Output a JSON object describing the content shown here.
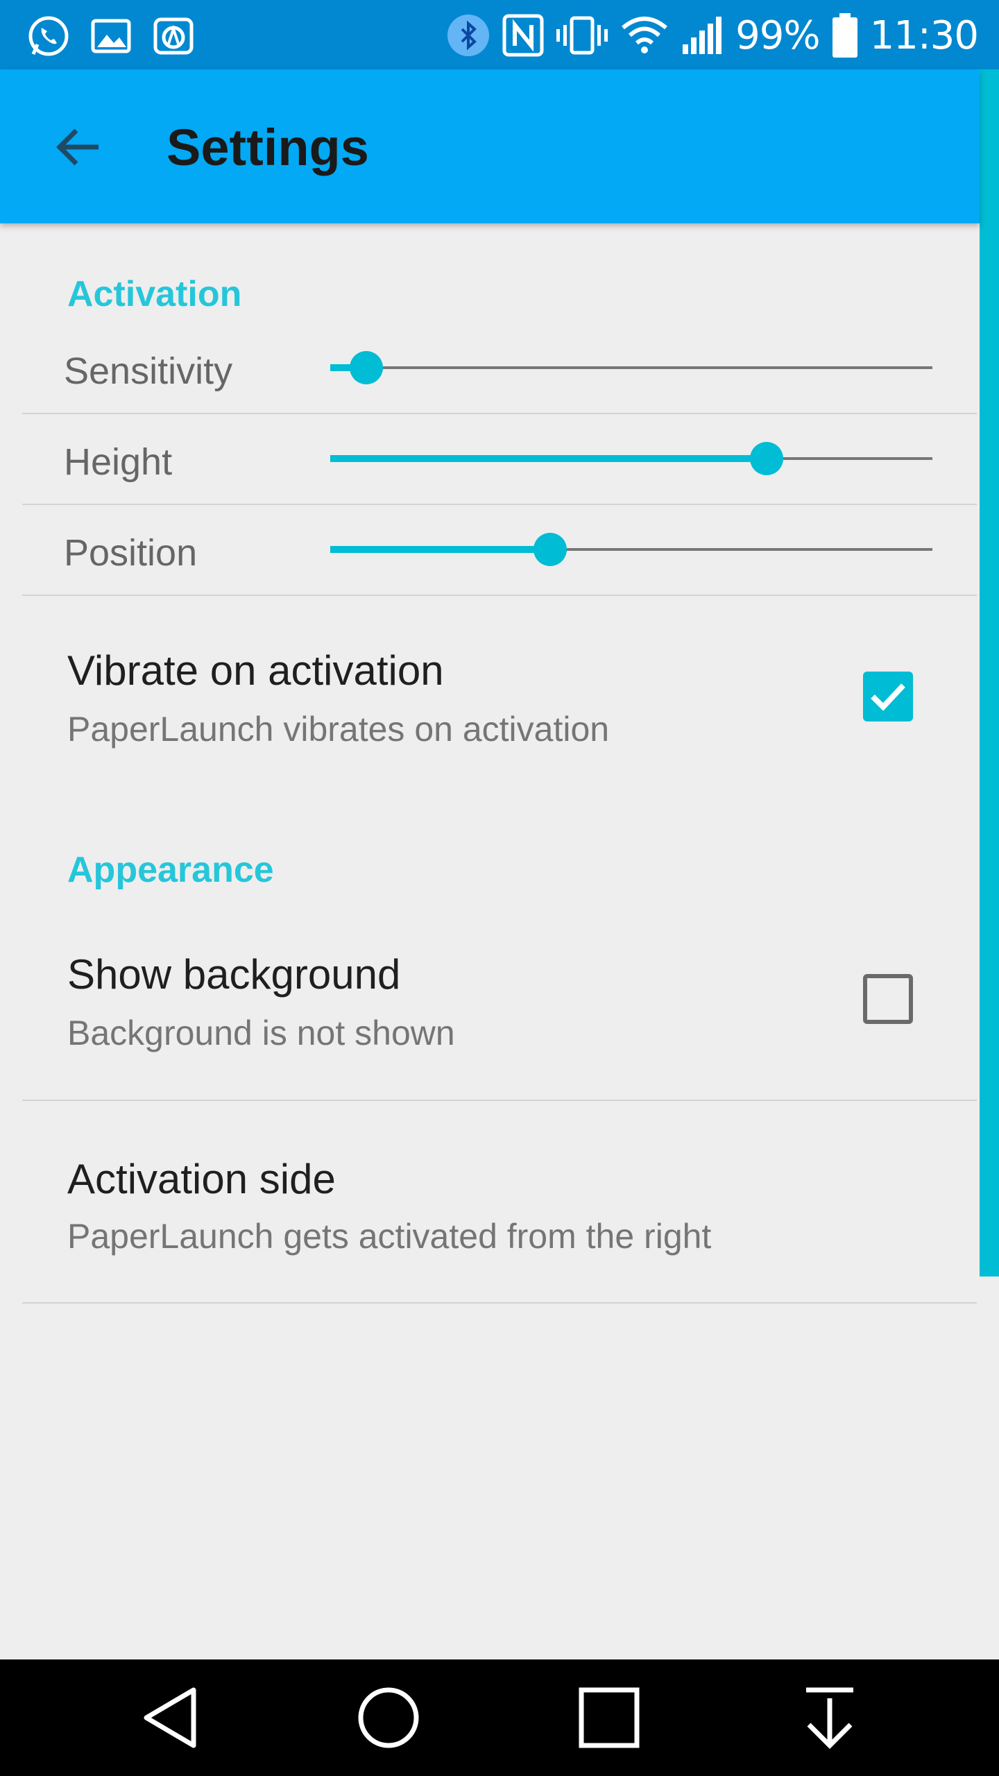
{
  "status_bar": {
    "left_icons": [
      "whatsapp-icon",
      "gallery-icon",
      "app-notification-icon"
    ],
    "right_icons": [
      "bluetooth-icon",
      "nfc-icon",
      "vibrate-icon",
      "wifi-icon",
      "signal-icon"
    ],
    "battery_percent": "99%",
    "time": "11:30"
  },
  "app_bar": {
    "back_icon": "arrow-back-icon",
    "title": "Settings"
  },
  "sections": {
    "activation": {
      "header": "Activation",
      "sliders": [
        {
          "label": "Sensitivity",
          "value": 0.06
        },
        {
          "label": "Height",
          "value": 0.725
        },
        {
          "label": "Position",
          "value": 0.365
        }
      ],
      "vibrate": {
        "title": "Vibrate on activation",
        "summary": "PaperLaunch vibrates on activation",
        "checked": true
      }
    },
    "appearance": {
      "header": "Appearance",
      "show_background": {
        "title": "Show background",
        "summary": "Background is not shown",
        "checked": false
      },
      "activation_side": {
        "title": "Activation side",
        "summary": "PaperLaunch gets activated from the right"
      }
    }
  },
  "nav_bar": {
    "buttons": [
      "back-triangle-icon",
      "home-circle-icon",
      "recents-square-icon",
      "notification-pulldown-icon"
    ]
  },
  "colors": {
    "status_bar": "#0288d1",
    "app_bar": "#03a9f4",
    "accent": "#00bcd4",
    "background": "#eeeeee"
  }
}
